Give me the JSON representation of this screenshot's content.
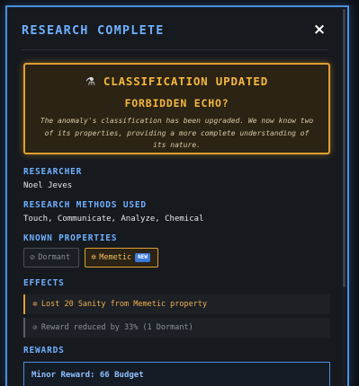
{
  "modal": {
    "title": "RESEARCH COMPLETE",
    "close_label": "×"
  },
  "alert": {
    "icon": "flask-icon",
    "flask_glyph": "⚗",
    "heading": "CLASSIFICATION UPDATED",
    "subheading": "FORBIDDEN ECHO?",
    "body": "The anomaly's classification has been upgraded. We now know two of its properties, providing a more complete understanding of its nature."
  },
  "researcher": {
    "label": "RESEARCHER",
    "value": "Noel Jeves"
  },
  "methods": {
    "label": "RESEARCH METHODS USED",
    "value": "Touch, Communicate, Analyze, Chemical"
  },
  "properties": {
    "label": "KNOWN PROPERTIES",
    "items": [
      {
        "glyph": "⊘",
        "label": "Dormant",
        "state": "inactive"
      },
      {
        "glyph": "✲",
        "label": "Memetic",
        "badge": "NEW",
        "state": "active"
      }
    ]
  },
  "effects": {
    "label": "EFFECTS",
    "items": [
      {
        "glyph": "✲",
        "text": "Lost 20 Sanity from Memetic property"
      },
      {
        "glyph": "⊘",
        "text": "Reward reduced by 33% (1 Dormant)"
      }
    ]
  },
  "rewards": {
    "label": "REWARDS",
    "items": [
      {
        "text": "Minor Reward: 66 Budget"
      }
    ]
  },
  "colors": {
    "accent_blue": "#4a90e2",
    "warning_amber": "#e0a030",
    "panel_bg": "#16191e"
  }
}
